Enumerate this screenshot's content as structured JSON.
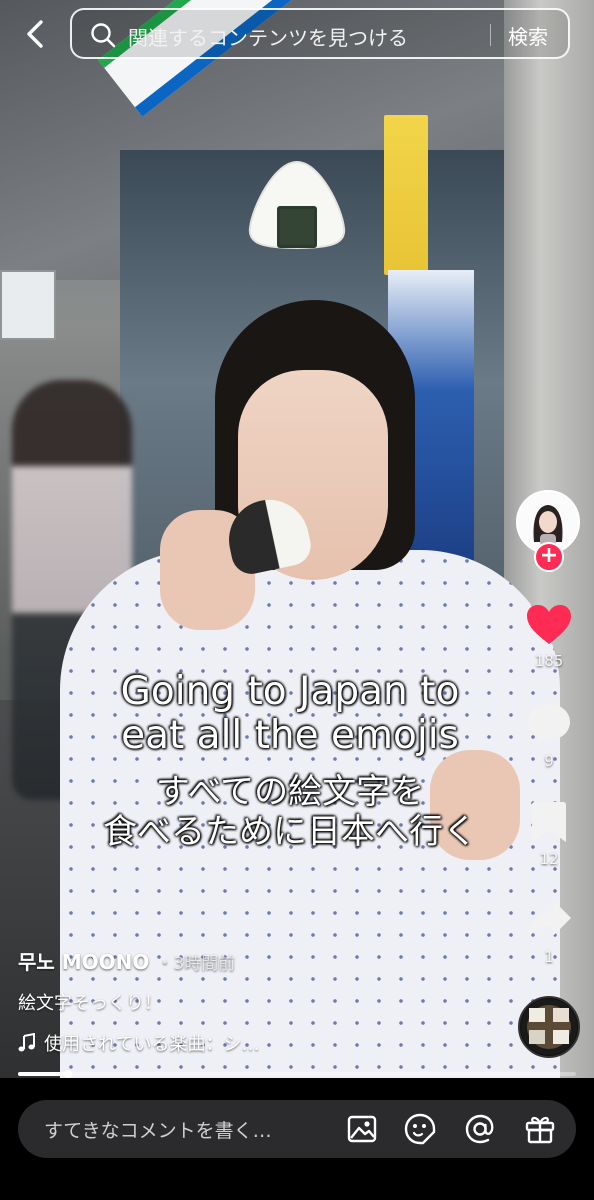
{
  "search": {
    "placeholder": "関連するコンテンツを見つける",
    "submit_label": "検索"
  },
  "video": {
    "caption_en_line1": "Going to Japan to",
    "caption_en_line2": "eat all the emojis",
    "caption_jp_line1": "すべての絵文字を",
    "caption_jp_line2": "食べるために日本へ行く",
    "progress_fraction": 0.09
  },
  "actions": {
    "likes": "185",
    "comments": "9",
    "saves": "12",
    "shares": "1"
  },
  "post": {
    "author": "무노 MOONO",
    "time_separator": "・",
    "time": "3時間前",
    "description": "絵文字そっくり！",
    "music": "使用されている楽曲：シ…"
  },
  "comment_bar": {
    "placeholder": "すてきなコメントを書く…"
  },
  "colors": {
    "accent": "#fe2c55",
    "like": "#fe2c55",
    "comment_bar_bg": "#2b2b2d"
  },
  "icons": {
    "back": "chevron-left-icon",
    "search": "search-icon",
    "like": "heart-icon",
    "comment": "comment-icon",
    "save": "bookmark-icon",
    "share": "share-icon",
    "music": "music-note-icon",
    "image": "image-icon",
    "sticker": "sticker-icon",
    "mention": "at-icon",
    "gift": "gift-icon"
  }
}
